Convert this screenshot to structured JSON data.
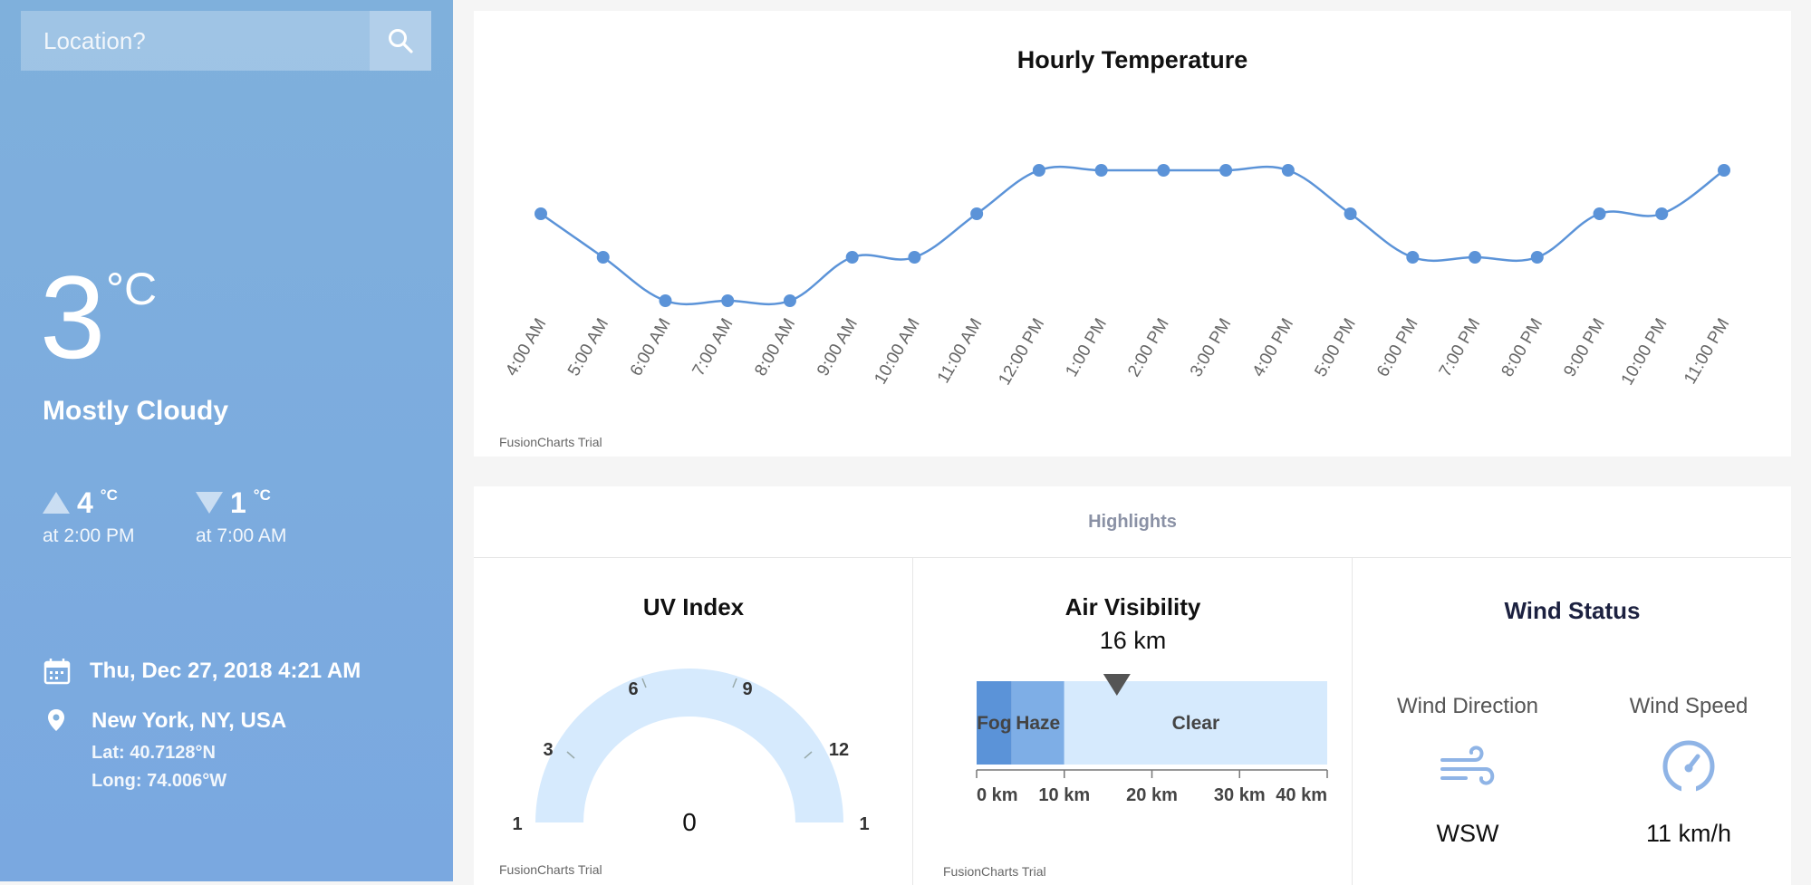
{
  "search": {
    "placeholder": "Location?"
  },
  "current": {
    "temperature": "3",
    "unit": "°C",
    "condition": "Mostly Cloudy",
    "high": {
      "value": "4",
      "unit": "°C",
      "time": "at 2:00 PM"
    },
    "low": {
      "value": "1",
      "unit": "°C",
      "time": "at 7:00 AM"
    },
    "datetime": "Thu, Dec 27, 2018 4:21 AM",
    "location": "New York, NY, USA",
    "lat": "Lat: 40.7128°N",
    "long": "Long: 74.006°W"
  },
  "colors": {
    "accent": "#5b93d8",
    "sidebar": "#7fb0dc",
    "gauge": "#d6eafd"
  },
  "chart_data": {
    "type": "line",
    "title": "Hourly Temperature",
    "x": [
      "4:00 AM",
      "5:00 AM",
      "6:00 AM",
      "7:00 AM",
      "8:00 AM",
      "9:00 AM",
      "10:00 AM",
      "11:00 AM",
      "12:00 PM",
      "1:00 PM",
      "2:00 PM",
      "3:00 PM",
      "4:00 PM",
      "5:00 PM",
      "6:00 PM",
      "7:00 PM",
      "8:00 PM",
      "9:00 PM",
      "10:00 PM",
      "11:00 PM"
    ],
    "series": [
      {
        "values": [
          3,
          2,
          1,
          1,
          1,
          2,
          2,
          3,
          4,
          4,
          4,
          4,
          4,
          3,
          2,
          2,
          2,
          3,
          3,
          4
        ]
      }
    ],
    "ylim": [
      1,
      4
    ],
    "grid": false,
    "watermark": "FusionCharts Trial"
  },
  "highlights": {
    "title": "Highlights",
    "uv": {
      "title": "UV Index",
      "value": "0",
      "ticks": [
        "3",
        "6",
        "9",
        "12"
      ],
      "min_label": "1",
      "max_label": "1",
      "watermark": "FusionCharts Trial"
    },
    "visibility": {
      "title": "Air Visibility",
      "value_label": "16 km",
      "value": 16,
      "bands": [
        {
          "label": "Fog",
          "from": 0,
          "to": 4,
          "color": "#5b93d8"
        },
        {
          "label": "Haze",
          "from": 4,
          "to": 10,
          "color": "#7eaee6"
        },
        {
          "label": "Clear",
          "from": 10,
          "to": 40,
          "color": "#d6eafd"
        }
      ],
      "ticks": [
        "0 km",
        "10 km",
        "20 km",
        "30 km",
        "40 km"
      ],
      "watermark": "FusionCharts Trial"
    },
    "wind": {
      "title": "Wind Status",
      "direction_label": "Wind Direction",
      "direction_value": "WSW",
      "speed_label": "Wind Speed",
      "speed_value": "11 km/h",
      "direction_icon": "wind-icon",
      "speed_icon": "speedometer-icon"
    }
  }
}
